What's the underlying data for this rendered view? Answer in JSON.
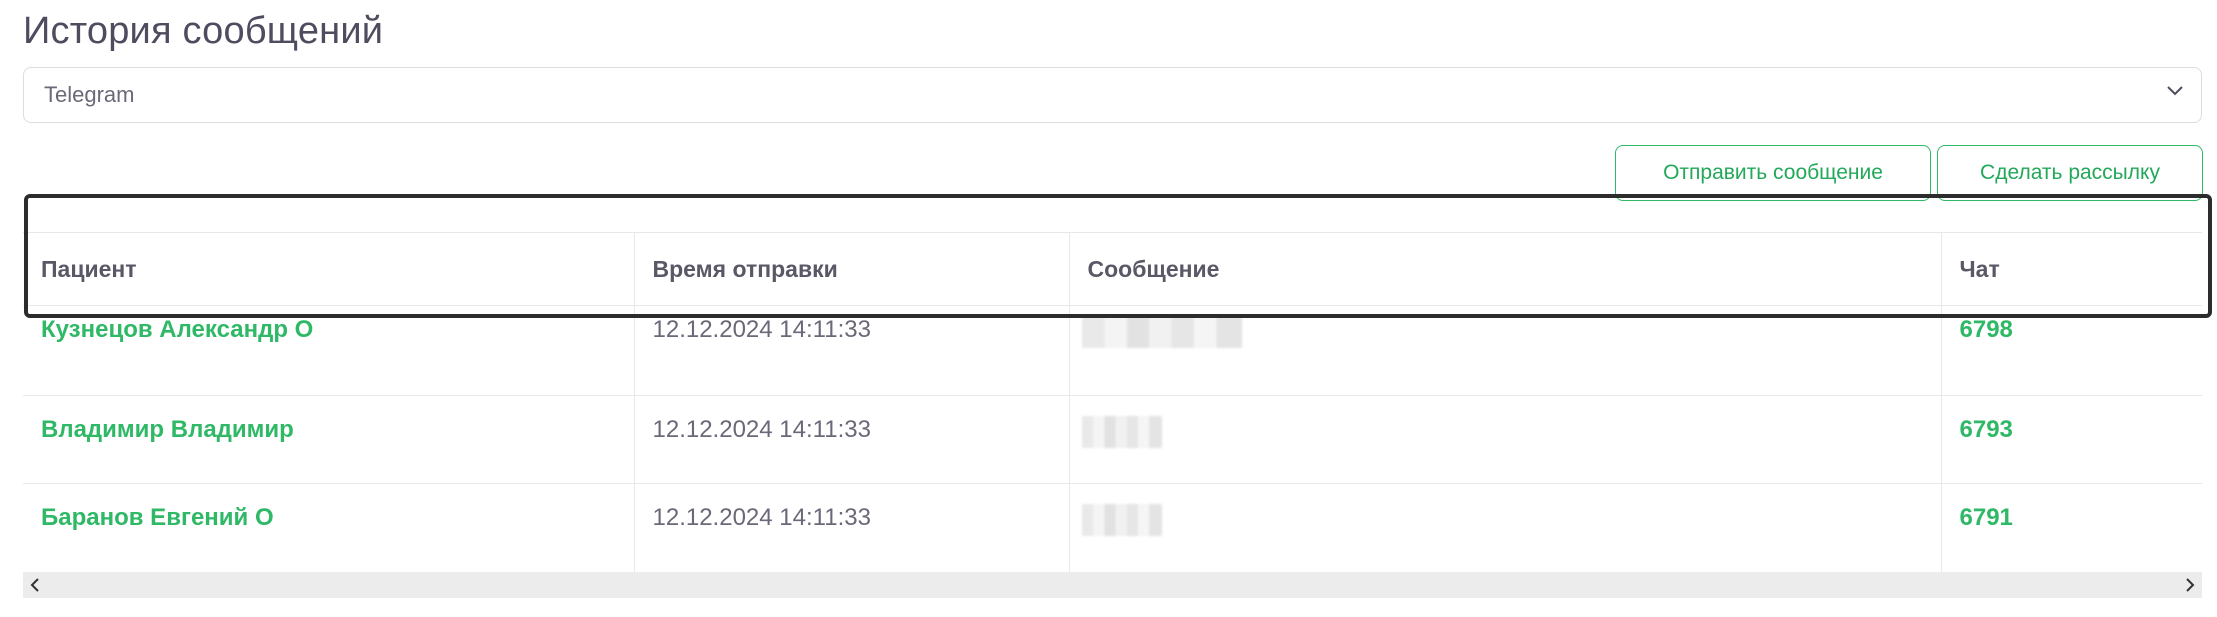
{
  "page": {
    "title": "История сообщений"
  },
  "messenger_select": {
    "value": "Telegram"
  },
  "actions": {
    "send_label": "Отправить сообщение",
    "broadcast_label": "Сделать рассылку"
  },
  "table": {
    "columns": [
      "Пациент",
      "Время отправки",
      "Сообщение",
      "Чат"
    ],
    "rows": [
      {
        "patient": "Кузнецов Александр О",
        "time": "12.12.2024 14:11:33",
        "message": "",
        "chat": "6798"
      },
      {
        "patient": "Владимир Владимир",
        "time": "12.12.2024 14:11:33",
        "message": "",
        "chat": "6793"
      },
      {
        "patient": "Баранов Евгений О",
        "time": "12.12.2024 14:11:33",
        "message": "",
        "chat": "6791"
      }
    ]
  },
  "colors": {
    "accent": "#2fb866",
    "title": "#4f4c5f",
    "highlight_border": "#2c2c2c"
  },
  "icons": {
    "select": "chevron-down-icon",
    "scroll_left": "chevron-left-icon",
    "scroll_right": "chevron-right-icon"
  }
}
